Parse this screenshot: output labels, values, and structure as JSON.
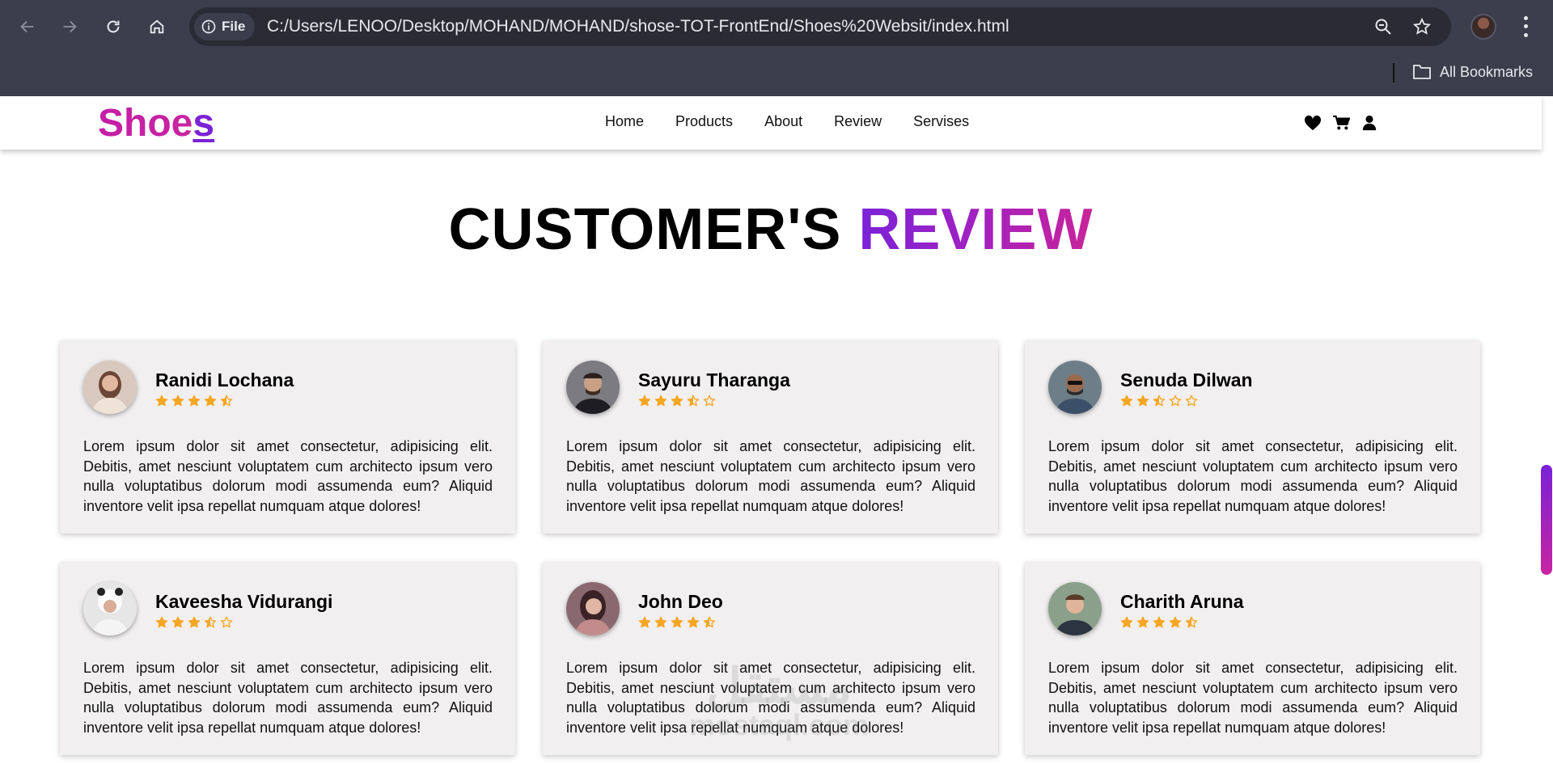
{
  "browser": {
    "url": "C:/Users/LENOO/Desktop/MOHAND/MOHAND/shose-TOT-FrontEnd/Shoes%20Websit/index.html",
    "site_chip_label": "File",
    "bookmarks_label": "All Bookmarks"
  },
  "site": {
    "logo_main": "Shoe",
    "logo_last": "s",
    "nav": [
      "Home",
      "Products",
      "About",
      "Review",
      "Servises"
    ]
  },
  "section": {
    "title_part1": "CUSTOMER'S",
    "title_part2": "REVIEW"
  },
  "colors": {
    "accent_purple": "#7a22d8",
    "accent_pink": "#c824a2",
    "star": "#f5a623",
    "card_bg": "#f1eff0"
  },
  "reviews": [
    {
      "name": "Ranidi Lochana",
      "rating": 4.5,
      "avatar_icon": "woman-avatar",
      "text": "Lorem ipsum dolor sit amet consectetur, adipisicing elit. Debitis, amet nesciunt voluptatem cum architecto ipsum vero nulla voluptatibus dolorum modi assumenda eum? Aliquid inventore velit ipsa repellat numquam atque dolores!"
    },
    {
      "name": "Sayuru Tharanga",
      "rating": 3.5,
      "avatar_icon": "man-avatar",
      "text": "Lorem ipsum dolor sit amet consectetur, adipisicing elit. Debitis, amet nesciunt voluptatem cum architecto ipsum vero nulla voluptatibus dolorum modi assumenda eum? Aliquid inventore velit ipsa repellat numquam atque dolores!"
    },
    {
      "name": "Senuda Dilwan",
      "rating": 2.5,
      "avatar_icon": "man-avatar",
      "text": "Lorem ipsum dolor sit amet consectetur, adipisicing elit. Debitis, amet nesciunt voluptatem cum architecto ipsum vero nulla voluptatibus dolorum modi assumenda eum? Aliquid inventore velit ipsa repellat numquam atque dolores!"
    },
    {
      "name": "Kaveesha Vidurangi",
      "rating": 3.5,
      "avatar_icon": "woman-avatar",
      "text": "Lorem ipsum dolor sit amet consectetur, adipisicing elit. Debitis, amet nesciunt voluptatem cum architecto ipsum vero nulla voluptatibus dolorum modi assumenda eum? Aliquid inventore velit ipsa repellat numquam atque dolores!"
    },
    {
      "name": "John Deo",
      "rating": 4.5,
      "avatar_icon": "woman-avatar",
      "text": "Lorem ipsum dolor sit amet consectetur, adipisicing elit. Debitis, amet nesciunt voluptatem cum architecto ipsum vero nulla voluptatibus dolorum modi assumenda eum? Aliquid inventore velit ipsa repellat numquam atque dolores!"
    },
    {
      "name": "Charith Aruna",
      "rating": 4.5,
      "avatar_icon": "man-avatar",
      "text": "Lorem ipsum dolor sit amet consectetur, adipisicing elit. Debitis, amet nesciunt voluptatem cum architecto ipsum vero nulla voluptatibus dolorum modi assumenda eum? Aliquid inventore velit ipsa repellat numquam atque dolores!"
    }
  ],
  "watermark": {
    "line1": "مستقل",
    "line2": "mostaql.com"
  }
}
